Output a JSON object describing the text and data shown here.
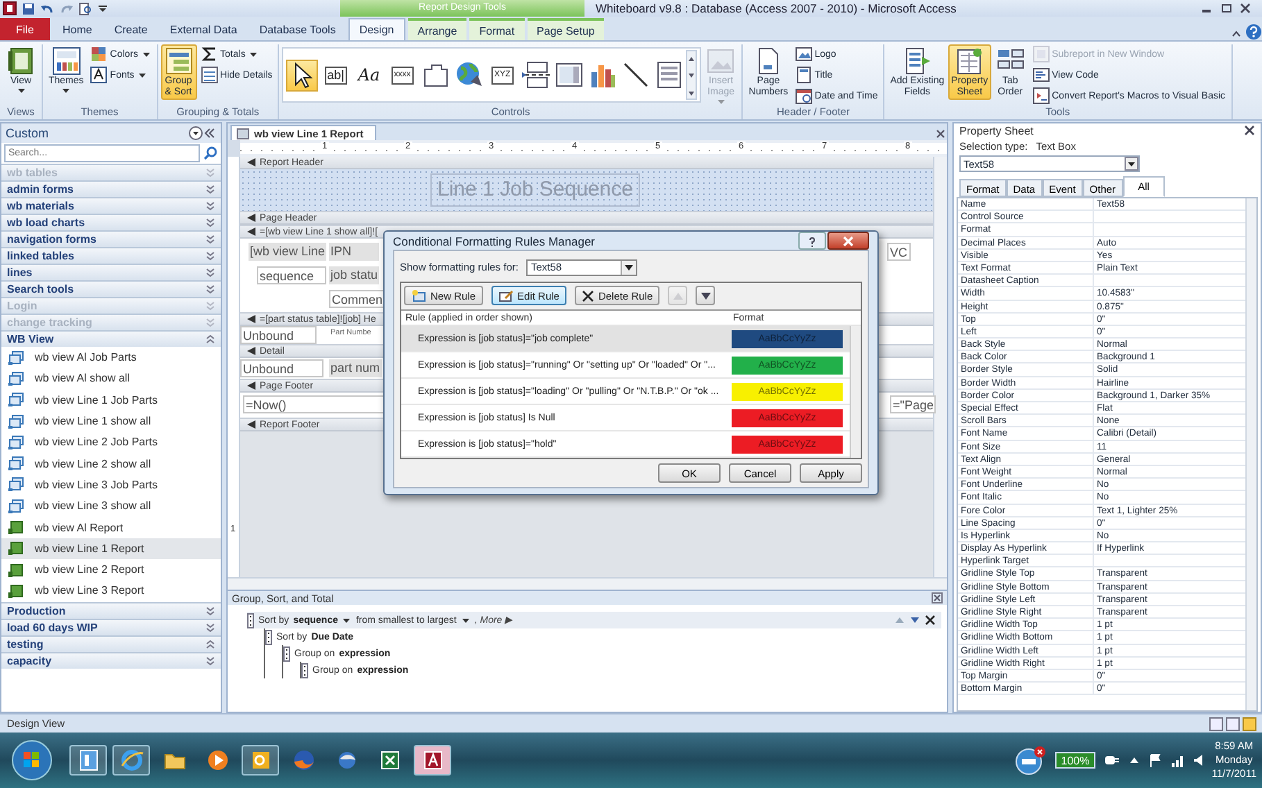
{
  "window": {
    "title": "Whiteboard v9.8 : Database (Access 2007 - 2010)  -  Microsoft Access",
    "context_header": "Report Design Tools"
  },
  "ribbon_tabs": [
    {
      "label": "File",
      "kind": "file",
      "selected": false,
      "contextual": false
    },
    {
      "label": "Home",
      "kind": "tab",
      "selected": false,
      "contextual": false
    },
    {
      "label": "Create",
      "kind": "tab",
      "selected": false,
      "contextual": false
    },
    {
      "label": "External Data",
      "kind": "tab",
      "selected": false,
      "contextual": false
    },
    {
      "label": "Database Tools",
      "kind": "tab",
      "selected": false,
      "contextual": false
    },
    {
      "label": "Design",
      "kind": "tab",
      "selected": true,
      "contextual": true
    },
    {
      "label": "Arrange",
      "kind": "tab",
      "selected": false,
      "contextual": true
    },
    {
      "label": "Format",
      "kind": "tab",
      "selected": false,
      "contextual": true
    },
    {
      "label": "Page Setup",
      "kind": "tab",
      "selected": false,
      "contextual": true
    }
  ],
  "ribbon_groups": [
    {
      "label": "Views",
      "items": [
        {
          "label": "View",
          "kind": "large",
          "dropdown": true,
          "selected": false,
          "disabled": false
        }
      ]
    },
    {
      "label": "Themes",
      "items": [
        {
          "label": "Themes",
          "kind": "large",
          "dropdown": true,
          "selected": false,
          "disabled": false
        },
        {
          "label": "Colors",
          "kind": "small",
          "dropdown": true,
          "selected": false,
          "disabled": false
        },
        {
          "label": "Fonts",
          "kind": "small",
          "dropdown": true,
          "selected": false,
          "disabled": false
        }
      ]
    },
    {
      "label": "Grouping & Totals",
      "items": [
        {
          "label": "Group\n& Sort",
          "kind": "large",
          "dropdown": false,
          "selected": true,
          "disabled": false
        },
        {
          "label": "Totals",
          "kind": "small",
          "dropdown": true,
          "selected": false,
          "disabled": false
        },
        {
          "label": "Hide Details",
          "kind": "small",
          "dropdown": false,
          "selected": false,
          "disabled": false
        }
      ]
    },
    {
      "label": "Controls",
      "items": [
        {
          "kind": "tool",
          "selected": true,
          "disabled": false
        },
        {
          "kind": "tool",
          "glyph": "ab|",
          "selected": false,
          "disabled": false
        },
        {
          "kind": "tool",
          "glyph": "Aa",
          "selected": false,
          "disabled": false
        },
        {
          "kind": "tool",
          "glyph": "xxxx",
          "selected": false,
          "disabled": false
        },
        {
          "kind": "tool",
          "selected": false,
          "disabled": false
        },
        {
          "kind": "tool",
          "selected": false,
          "disabled": false
        },
        {
          "kind": "tool",
          "glyph": "XYZ",
          "selected": false,
          "disabled": false
        },
        {
          "kind": "tool",
          "selected": false,
          "disabled": false
        },
        {
          "kind": "tool",
          "selected": false,
          "disabled": false
        },
        {
          "kind": "tool",
          "selected": false,
          "disabled": false
        },
        {
          "kind": "tool",
          "selected": false,
          "disabled": false
        },
        {
          "kind": "tool",
          "selected": false,
          "disabled": false
        },
        {
          "label": "Insert\nImage",
          "kind": "large",
          "dropdown": true,
          "selected": false,
          "disabled": true
        }
      ]
    },
    {
      "label": "Header / Footer",
      "items": [
        {
          "label": "Page\nNumbers",
          "kind": "large",
          "dropdown": false,
          "selected": false,
          "disabled": false
        },
        {
          "label": "Logo",
          "kind": "small",
          "dropdown": false,
          "selected": false,
          "disabled": false
        },
        {
          "label": "Title",
          "kind": "small",
          "dropdown": false,
          "selected": false,
          "disabled": false
        },
        {
          "label": "Date and Time",
          "kind": "small",
          "dropdown": false,
          "selected": false,
          "disabled": false
        }
      ]
    },
    {
      "label": "Tools",
      "items": [
        {
          "label": "Add Existing\nFields",
          "kind": "large",
          "dropdown": false,
          "selected": false,
          "disabled": false
        },
        {
          "label": "Property\nSheet",
          "kind": "large",
          "dropdown": false,
          "selected": true,
          "disabled": false
        },
        {
          "label": "Tab\nOrder",
          "kind": "large",
          "dropdown": false,
          "selected": false,
          "disabled": false
        },
        {
          "label": "Subreport in New Window",
          "kind": "small",
          "dropdown": false,
          "selected": false,
          "disabled": true
        },
        {
          "label": "View Code",
          "kind": "small",
          "dropdown": false,
          "selected": false,
          "disabled": false
        },
        {
          "label": "Convert Report's Macros to Visual Basic",
          "kind": "small",
          "dropdown": false,
          "selected": false,
          "disabled": false
        }
      ]
    }
  ],
  "nav": {
    "title": "Custom",
    "search_placeholder": "Search...",
    "groups": [
      {
        "label": "wb tables",
        "disabled": true,
        "expanded": false
      },
      {
        "label": "admin forms",
        "disabled": false,
        "expanded": false
      },
      {
        "label": "wb materials",
        "disabled": false,
        "expanded": false
      },
      {
        "label": "wb load charts",
        "disabled": false,
        "expanded": false
      },
      {
        "label": "navigation forms",
        "disabled": false,
        "expanded": false
      },
      {
        "label": "linked tables",
        "disabled": false,
        "expanded": false
      },
      {
        "label": "lines",
        "disabled": false,
        "expanded": false
      },
      {
        "label": "Search tools",
        "disabled": false,
        "expanded": false
      },
      {
        "label": "Login",
        "disabled": true,
        "expanded": false
      },
      {
        "label": "change tracking",
        "disabled": true,
        "expanded": false
      },
      {
        "label": "WB View",
        "disabled": false,
        "expanded": true,
        "items": [
          {
            "label": "wb view Al Job Parts",
            "kind": "form",
            "selected": false
          },
          {
            "label": "wb view Al show all",
            "kind": "form",
            "selected": false
          },
          {
            "label": "wb view Line 1 Job Parts",
            "kind": "form",
            "selected": false
          },
          {
            "label": "wb view Line 1 show all",
            "kind": "form",
            "selected": false
          },
          {
            "label": "wb view Line 2 Job Parts",
            "kind": "form",
            "selected": false
          },
          {
            "label": "wb view Line 2 show all",
            "kind": "form",
            "selected": false
          },
          {
            "label": "wb view Line 3 Job Parts",
            "kind": "form",
            "selected": false
          },
          {
            "label": "wb view Line 3 show all",
            "kind": "form",
            "selected": false
          },
          {
            "label": "wb view Al Report",
            "kind": "report",
            "selected": false
          },
          {
            "label": "wb view Line 1 Report",
            "kind": "report",
            "selected": true
          },
          {
            "label": "wb view Line 2 Report",
            "kind": "report",
            "selected": false
          },
          {
            "label": "wb view Line 3 Report",
            "kind": "report",
            "selected": false
          }
        ]
      },
      {
        "label": "Production",
        "disabled": false,
        "expanded": false
      },
      {
        "label": "load 60 days WIP",
        "disabled": false,
        "expanded": false
      },
      {
        "label": "testing",
        "disabled": false,
        "expanded": true
      },
      {
        "label": "capacity",
        "disabled": false,
        "expanded": false
      }
    ]
  },
  "report": {
    "tab_title": "wb view Line 1 Report",
    "ruler_labels": [
      "1",
      "2",
      "3",
      "4",
      "5",
      "6",
      "7",
      "8"
    ],
    "vertical_ruler_labels": [
      "1"
    ],
    "sections": [
      {
        "band": "Report Header",
        "dotted_grid": true,
        "controls": [
          {
            "text": "Line 1 Job Sequence",
            "kind": "title"
          }
        ]
      },
      {
        "band": "Page Header",
        "dotted_grid": false
      },
      {
        "band": "=[wb view Line 1 show all]![",
        "dotted_grid": false,
        "controls": [
          {
            "text": "[wb view Line",
            "kind": "label"
          },
          {
            "text": "IPN",
            "kind": "label"
          },
          {
            "text": "sequence",
            "kind": "textbox"
          },
          {
            "text": "job statu",
            "kind": "label"
          },
          {
            "text": "Commen",
            "kind": "textbox"
          },
          {
            "text": "VC",
            "kind": "textbox"
          }
        ]
      },
      {
        "band": "=[part status table]![job] He",
        "dotted_grid": false,
        "controls": [
          {
            "text": "Unbound",
            "kind": "textbox"
          },
          {
            "text": "Part Numbe",
            "kind": "caption"
          }
        ]
      },
      {
        "band": "Detail",
        "dotted_grid": false,
        "controls": [
          {
            "text": "Unbound",
            "kind": "textbox"
          },
          {
            "text": "part num",
            "kind": "label"
          }
        ]
      },
      {
        "band": "Page Footer",
        "dotted_grid": false,
        "controls": [
          {
            "text": "=Now()",
            "kind": "textbox"
          },
          {
            "text": "=\"Page",
            "kind": "textbox"
          }
        ]
      },
      {
        "band": "Report Footer",
        "dotted_grid": false
      }
    ]
  },
  "dialog": {
    "title": "Conditional Formatting Rules Manager",
    "show_label": "Show formatting rules for:",
    "show_value": "Text58",
    "buttons": [
      {
        "label": "New Rule",
        "kind": "new",
        "selected": false,
        "disabled": false
      },
      {
        "label": "Edit Rule",
        "kind": "edit",
        "selected": true,
        "disabled": false
      },
      {
        "label": "Delete Rule",
        "kind": "delete",
        "selected": false,
        "disabled": false
      },
      {
        "kind": "up",
        "selected": false,
        "disabled": true
      },
      {
        "kind": "down",
        "selected": false,
        "disabled": false
      }
    ],
    "columns": [
      "Rule (applied in order shown)",
      "Format"
    ],
    "rules": [
      {
        "text": "Expression is [job status]=\"job complete\"",
        "sample": "AaBbCcYyZz",
        "color": "#1f4a80",
        "selected": true
      },
      {
        "text": "Expression is [job status]=\"running\" Or \"setting up\" Or \"loaded\" Or \"...",
        "sample": "AaBbCcYyZz",
        "color": "#22b04a",
        "selected": false
      },
      {
        "text": "Expression is [job status]=\"loading\" Or \"pulling\" Or \"N.T.B.P.\" Or \"ok ...",
        "sample": "AaBbCcYyZz",
        "color": "#f8f000",
        "selected": false
      },
      {
        "text": "Expression is [job status] Is Null",
        "sample": "AaBbCcYyZz",
        "color": "#ec1c24",
        "selected": false
      },
      {
        "text": "Expression is [job status]=\"hold\"",
        "sample": "AaBbCcYyZz",
        "color": "#ec1c24",
        "selected": false
      }
    ],
    "actions": [
      "OK",
      "Cancel",
      "Apply"
    ]
  },
  "group_sort": {
    "title": "Group, Sort, and Total",
    "levels": [
      {
        "prefix": "Sort by",
        "field": "sequence",
        "order": "from smallest to largest",
        "more": ", More ▶",
        "selected": true,
        "children": [
          {
            "prefix": "Sort by",
            "field": "Due Date",
            "selected": false,
            "children": [
              {
                "prefix": "Group on",
                "field": "expression",
                "selected": false,
                "children": [
                  {
                    "prefix": "Group on",
                    "field": "expression",
                    "selected": false
                  }
                ]
              }
            ]
          }
        ]
      }
    ]
  },
  "property_sheet": {
    "title": "Property Sheet",
    "selection_label": "Selection type:",
    "selection_value": "Text Box",
    "object": "Text58",
    "tabs": [
      {
        "label": "Format",
        "selected": false
      },
      {
        "label": "Data",
        "selected": false
      },
      {
        "label": "Event",
        "selected": false
      },
      {
        "label": "Other",
        "selected": false
      },
      {
        "label": "All",
        "selected": true
      }
    ],
    "rows": [
      {
        "name": "Name",
        "value": "Text58"
      },
      {
        "name": "Control Source"
      },
      {
        "name": "Format"
      },
      {
        "name": "Decimal Places",
        "value": "Auto"
      },
      {
        "name": "Visible",
        "value": "Yes"
      },
      {
        "name": "Text Format",
        "value": "Plain Text"
      },
      {
        "name": "Datasheet Caption"
      },
      {
        "name": "Width",
        "value": "10.4583\""
      },
      {
        "name": "Height",
        "value": "0.875\""
      },
      {
        "name": "Top",
        "value": "0\""
      },
      {
        "name": "Left",
        "value": "0\""
      },
      {
        "name": "Back Style",
        "value": "Normal"
      },
      {
        "name": "Back Color",
        "value": "Background 1"
      },
      {
        "name": "Border Style",
        "value": "Solid"
      },
      {
        "name": "Border Width",
        "value": "Hairline"
      },
      {
        "name": "Border Color",
        "value": "Background 1, Darker 35%"
      },
      {
        "name": "Special Effect",
        "value": "Flat"
      },
      {
        "name": "Scroll Bars",
        "value": "None"
      },
      {
        "name": "Font Name",
        "value": "Calibri (Detail)"
      },
      {
        "name": "Font Size",
        "value": "11"
      },
      {
        "name": "Text Align",
        "value": "General"
      },
      {
        "name": "Font Weight",
        "value": "Normal"
      },
      {
        "name": "Font Underline",
        "value": "No"
      },
      {
        "name": "Font Italic",
        "value": "No"
      },
      {
        "name": "Fore Color",
        "value": "Text 1, Lighter 25%"
      },
      {
        "name": "Line Spacing",
        "value": "0\""
      },
      {
        "name": "Is Hyperlink",
        "value": "No"
      },
      {
        "name": "Display As Hyperlink",
        "value": "If Hyperlink"
      },
      {
        "name": "Hyperlink Target"
      },
      {
        "name": "Gridline Style Top",
        "value": "Transparent"
      },
      {
        "name": "Gridline Style Bottom",
        "value": "Transparent"
      },
      {
        "name": "Gridline Style Left",
        "value": "Transparent"
      },
      {
        "name": "Gridline Style Right",
        "value": "Transparent"
      },
      {
        "name": "Gridline Width Top",
        "value": "1 pt"
      },
      {
        "name": "Gridline Width Bottom",
        "value": "1 pt"
      },
      {
        "name": "Gridline Width Left",
        "value": "1 pt"
      },
      {
        "name": "Gridline Width Right",
        "value": "1 pt"
      },
      {
        "name": "Top Margin",
        "value": "0\""
      },
      {
        "name": "Bottom Margin",
        "value": "0\""
      }
    ]
  },
  "status_bar": {
    "text": "Design View"
  },
  "taskbar": {
    "apps": [
      {
        "running": true,
        "selected": false
      },
      {
        "running": true,
        "selected": false
      },
      {
        "running": false,
        "selected": false
      },
      {
        "running": false,
        "selected": false
      },
      {
        "running": true,
        "selected": false
      },
      {
        "running": false,
        "selected": false
      },
      {
        "running": false,
        "selected": false
      },
      {
        "running": false,
        "selected": false
      },
      {
        "running": true,
        "selected": true
      }
    ],
    "battery": "100%",
    "time": "8:59 AM",
    "day": "Monday",
    "date": "11/7/2011"
  }
}
